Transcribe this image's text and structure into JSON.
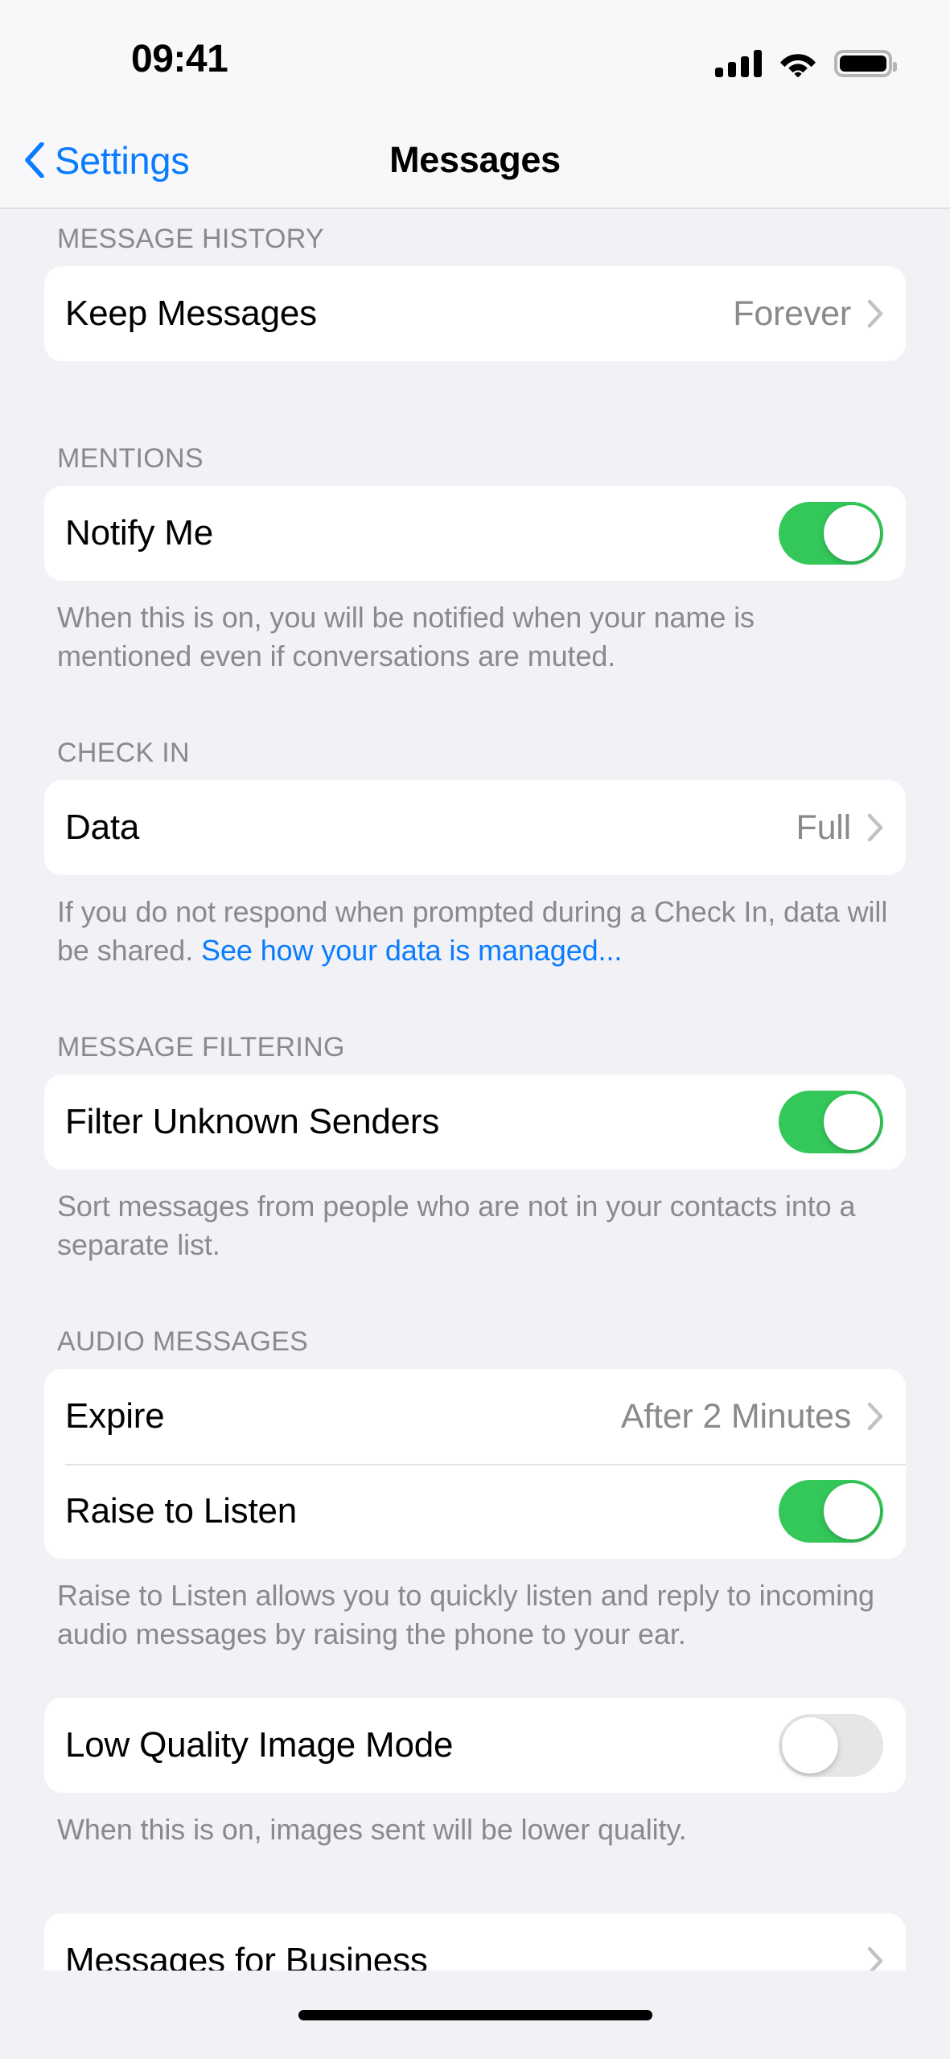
{
  "status_bar": {
    "time": "09:41",
    "signal_icon": "cellular-signal-icon",
    "wifi_icon": "wifi-icon",
    "battery_icon": "battery-full-icon"
  },
  "nav": {
    "back_label": "Settings",
    "back_icon": "chevron-left-icon",
    "title": "Messages"
  },
  "colors": {
    "accent_blue": "#0A7CFF",
    "toggle_on_green": "#34C759",
    "toggle_off_gray": "#E6E6E9",
    "page_background": "#F1F1F6",
    "card_background": "#FFFFFF",
    "secondary_text": "#8A8A8E"
  },
  "sections": [
    {
      "header": "MESSAGE HISTORY",
      "rows": [
        {
          "label": "Keep Messages",
          "value": "Forever",
          "type": "disclosure"
        }
      ],
      "footer": ""
    },
    {
      "header": "MENTIONS",
      "rows": [
        {
          "label": "Notify Me",
          "type": "toggle",
          "state": "on"
        }
      ],
      "footer": "When this is on, you will be notified when your name is mentioned even if conversations are muted."
    },
    {
      "header": "CHECK IN",
      "rows": [
        {
          "label": "Data",
          "value": "Full",
          "type": "disclosure"
        }
      ],
      "footer_prefix": "If you do not respond when prompted during a Check In, data will be shared. ",
      "footer_link": "See how your data is managed..."
    },
    {
      "header": "MESSAGE FILTERING",
      "rows": [
        {
          "label": "Filter Unknown Senders",
          "type": "toggle",
          "state": "on"
        }
      ],
      "footer": "Sort messages from people who are not in your contacts into a separate list."
    },
    {
      "header": "AUDIO MESSAGES",
      "rows": [
        {
          "label": "Expire",
          "value": "After 2 Minutes",
          "type": "disclosure"
        },
        {
          "label": "Raise to Listen",
          "type": "toggle",
          "state": "on"
        }
      ],
      "footer": "Raise to Listen allows you to quickly listen and reply to incoming audio messages by raising the phone to your ear."
    },
    {
      "header": "",
      "rows": [
        {
          "label": "Low Quality Image Mode",
          "type": "toggle",
          "state": "off"
        }
      ],
      "footer": "When this is on, images sent will be lower quality."
    },
    {
      "header": "",
      "rows": [
        {
          "label": "Messages for Business",
          "value": "",
          "type": "disclosure"
        }
      ],
      "footer": ""
    }
  ]
}
